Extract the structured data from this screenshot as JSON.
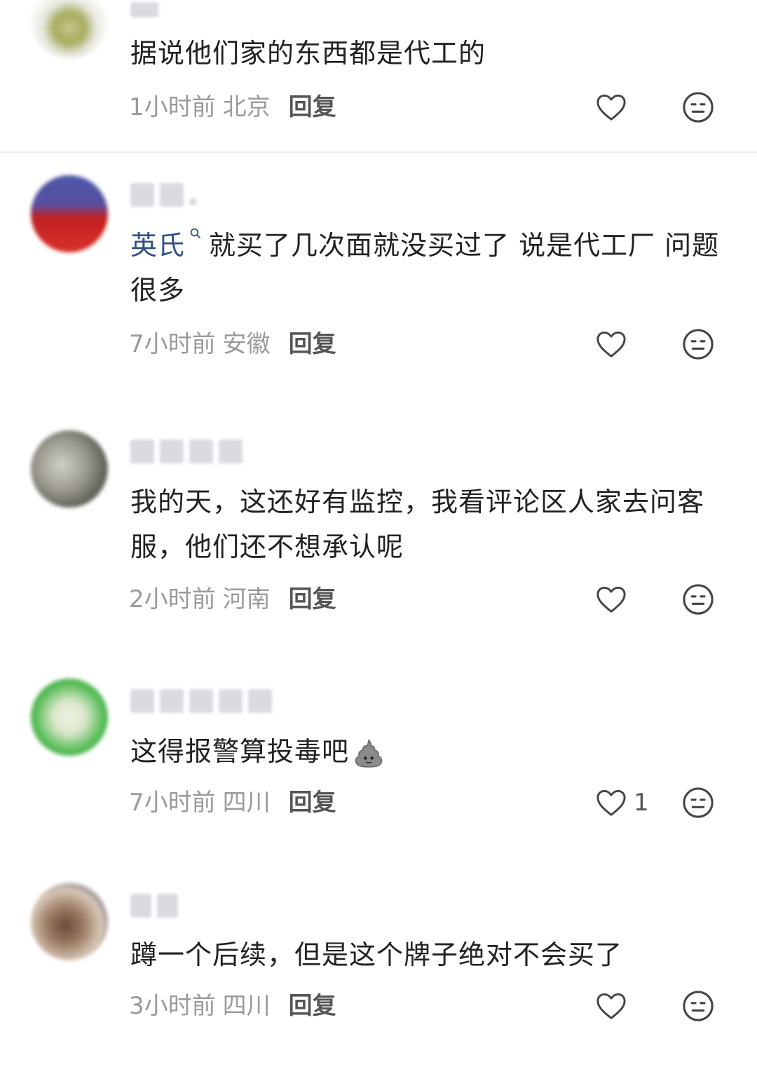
{
  "comments": [
    {
      "text": "据说他们家的东西都是代工的",
      "time": "1小时前",
      "location": "北京",
      "reply": "回复",
      "likes": ""
    },
    {
      "mention": "英氏",
      "text": "就买了几次面就没买过了 说是代工厂 问题很多",
      "time": "7小时前",
      "location": "安徽",
      "reply": "回复",
      "likes": ""
    },
    {
      "text": "我的天，这还好有监控，我看评论区人家去问客服，他们还不想承认呢",
      "time": "2小时前",
      "location": "河南",
      "reply": "回复",
      "likes": ""
    },
    {
      "text": "这得报警算投毒吧",
      "emoji": "poop-emoji",
      "time": "7小时前",
      "location": "四川",
      "reply": "回复",
      "likes": "1"
    },
    {
      "text": "蹲一个后续，但是这个牌子绝对不会买了",
      "time": "3小时前",
      "location": "四川",
      "reply": "回复",
      "likes": ""
    }
  ],
  "colors": {
    "text": "#222222",
    "meta": "#9a9a9a",
    "mention": "#2f4f8a",
    "reply": "#555555",
    "divider": "#efefef"
  },
  "icons": {
    "like": "heart-outline-icon",
    "dislike": "neutral-face-icon",
    "mention": "search-icon"
  }
}
